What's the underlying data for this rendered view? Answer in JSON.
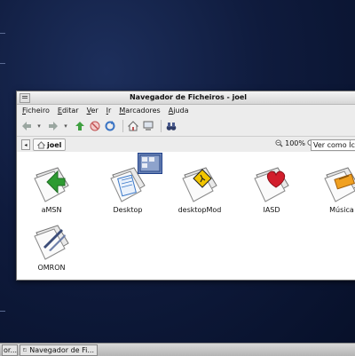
{
  "window": {
    "title": "Navegador de Ficheiros - joel"
  },
  "menubar": {
    "items": [
      {
        "label": "Ficheiro"
      },
      {
        "label": "Editar"
      },
      {
        "label": "Ver"
      },
      {
        "label": "Ir"
      },
      {
        "label": "Marcadores"
      },
      {
        "label": "Ajuda"
      }
    ]
  },
  "toolbar": {
    "buttons": [
      {
        "icon": "back-arrow-icon"
      },
      {
        "icon": "forward-arrow-icon"
      },
      {
        "icon": "up-arrow-icon"
      },
      {
        "icon": "stop-icon"
      },
      {
        "icon": "reload-icon"
      },
      {
        "icon": "home-icon"
      },
      {
        "icon": "computer-icon"
      },
      {
        "icon": "binoculars-icon"
      }
    ]
  },
  "location": {
    "crumb": "joel",
    "zoom": "100%",
    "view_mode": "Ver como Ícones"
  },
  "files": [
    {
      "name": "aMSN",
      "icon": "amsn-folder-icon",
      "badge_color": "#2e9b32"
    },
    {
      "name": "Desktop",
      "icon": "desktop-folder-icon",
      "badge_color": "#3a78c8"
    },
    {
      "name": "desktopMod",
      "icon": "desktopmod-folder-icon",
      "badge_color": "#f2c500"
    },
    {
      "name": "IASD",
      "icon": "iasd-folder-icon",
      "badge_color": "#d21e2c"
    },
    {
      "name": "Música",
      "icon": "music-folder-icon",
      "badge_color": "#f0a020"
    },
    {
      "name": "OMRON",
      "icon": "omron-folder-icon",
      "badge_color": "#3b4c78"
    }
  ],
  "taskbar": {
    "items": [
      {
        "label": "or..."
      },
      {
        "label": "Navegador de Fi..."
      }
    ]
  }
}
